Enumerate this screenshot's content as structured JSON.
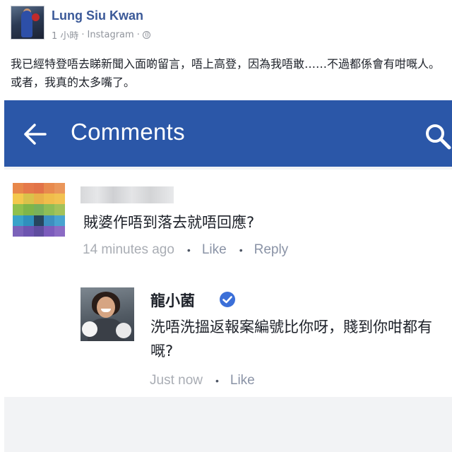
{
  "post": {
    "author": "Lung Siu Kwan",
    "time": "1 小時",
    "separator": "·",
    "source": "Instagram",
    "meta_separator": "·",
    "text": "我已經特登唔去睇新聞入面啲留言，唔上高登，因為我唔敢……不過都係會有咁嘅人。或者，我真的太多嘴了。"
  },
  "comments_screen": {
    "title": "Comments",
    "back_icon": "arrow-left-icon",
    "search_icon": "search-icon",
    "bar_color": "#2b57a8",
    "comment": {
      "text": "賊婆作唔到落去就唔回應?",
      "time": "14 minutes ago",
      "dot": "•",
      "like_label": "Like",
      "reply_label": "Reply"
    },
    "reply": {
      "name": "龍小菌",
      "text": "洗唔洗搵返報案編號比你呀，賤到你咁都有嘅?",
      "time": "Just now",
      "dot": "•",
      "like_label": "Like",
      "verified_color": "#3b6fd8"
    }
  }
}
